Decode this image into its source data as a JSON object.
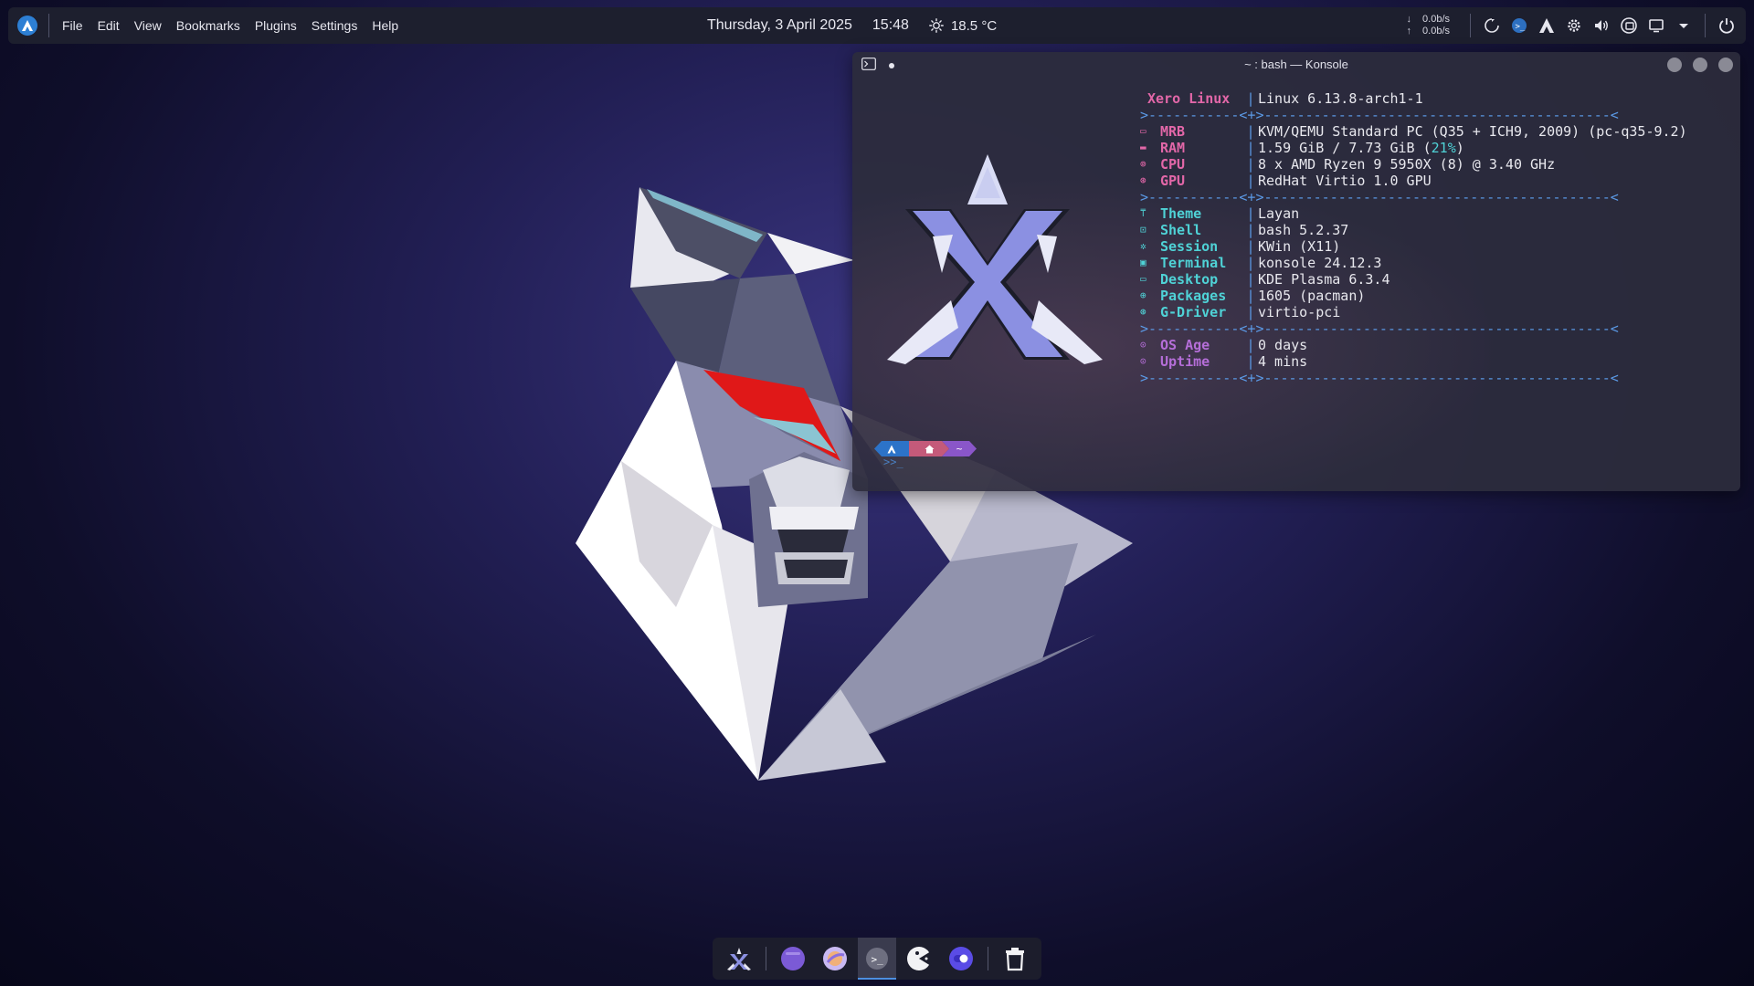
{
  "menubar": {
    "items": [
      "File",
      "Edit",
      "View",
      "Bookmarks",
      "Plugins",
      "Settings",
      "Help"
    ]
  },
  "clock": {
    "date": "Thursday, 3 April 2025",
    "time": "15:48",
    "temperature": "18.5 °C",
    "weather_icon": "sun-icon"
  },
  "tray": {
    "net_down_arrow": "↓",
    "net_up_arrow": "↑",
    "net_down": "0.0b/s",
    "net_up": "0.0b/s",
    "icons": [
      "updates-icon",
      "konsole-icon",
      "xero-icon",
      "settings-icon",
      "volume-icon",
      "network-icon",
      "display-icon",
      "expand-icon",
      "power-icon"
    ]
  },
  "konsole": {
    "title": "~ : bash — Konsole",
    "header_name": "Xero Linux",
    "header_value": "Linux 6.13.8-arch1-1",
    "separator_left": ">-----------<",
    "separator_mid": "+",
    "separator_right": ">------------------------------------------<",
    "hardware": [
      {
        "key": "MRB",
        "value": "KVM/QEMU Standard PC (Q35 + ICH9, 2009) (pc-q35-9.2)"
      },
      {
        "key": "RAM",
        "value": "1.59 GiB / 7.73 GiB (",
        "highlight": "21%",
        "suffix": ")"
      },
      {
        "key": "CPU",
        "value": "8 x AMD Ryzen 9 5950X (8) @ 3.40 GHz"
      },
      {
        "key": "GPU",
        "value": "RedHat Virtio 1.0 GPU"
      }
    ],
    "software": [
      {
        "key": "Theme",
        "value": "Layan"
      },
      {
        "key": "Shell",
        "value": "bash 5.2.37"
      },
      {
        "key": "Session",
        "value": "KWin (X11)"
      },
      {
        "key": "Terminal",
        "value": "konsole 24.12.3"
      },
      {
        "key": "Desktop",
        "value": "KDE Plasma 6.3.4"
      },
      {
        "key": "Packages",
        "value": "1605 (pacman)"
      },
      {
        "key": "G-Driver",
        "value": "virtio-pci"
      }
    ],
    "uptime": [
      {
        "key": "OS Age",
        "value": "0 days"
      },
      {
        "key": "Uptime",
        "value": "4 mins"
      }
    ],
    "prompt_tilde": "~",
    "prompt_cursor": ">>_"
  },
  "dock": {
    "items": [
      "xero-launcher-icon",
      "files-icon",
      "browser-icon",
      "konsole-icon",
      "pacman-icon",
      "toggle-icon"
    ],
    "active_index": 3,
    "trash": "trash-icon"
  },
  "colors": {
    "accent": "#2d7fd4",
    "pink": "#e267a8",
    "cyan": "#4fd2d6",
    "purple": "#b56ed8"
  }
}
